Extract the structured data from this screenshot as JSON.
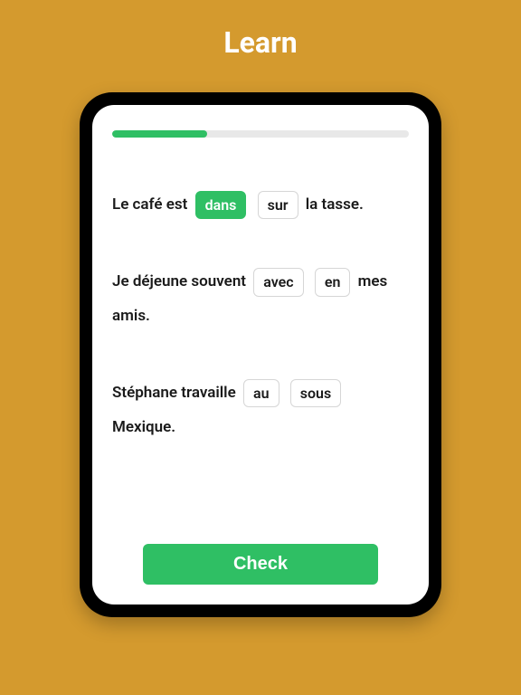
{
  "title": "Learn",
  "progress_percent": 32,
  "sentences": [
    {
      "parts": [
        {
          "type": "text",
          "value": "Le café est "
        },
        {
          "type": "choice",
          "value": "dans",
          "selected": true
        },
        {
          "type": "choice",
          "value": "sur",
          "selected": false
        },
        {
          "type": "text",
          "value": " la tasse."
        }
      ]
    },
    {
      "parts": [
        {
          "type": "text",
          "value": "Je déjeune souvent "
        },
        {
          "type": "choice",
          "value": "avec",
          "selected": false
        },
        {
          "type": "choice",
          "value": "en",
          "selected": false
        },
        {
          "type": "text",
          "value": " mes amis."
        }
      ]
    },
    {
      "parts": [
        {
          "type": "text",
          "value": "Stéphane travaille "
        },
        {
          "type": "choice",
          "value": "au",
          "selected": false
        },
        {
          "type": "choice",
          "value": "sous",
          "selected": false
        },
        {
          "type": "text",
          "value": " Mexique."
        }
      ]
    }
  ],
  "check_label": "Check",
  "colors": {
    "background": "#d49a2e",
    "accent": "#2fbf64"
  }
}
